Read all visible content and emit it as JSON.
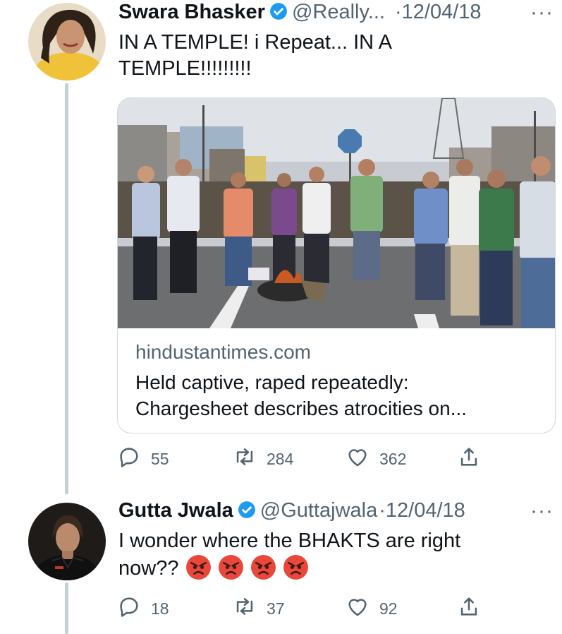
{
  "tweets": [
    {
      "name": "Swara Bhasker",
      "handle": "@Really...",
      "date": "·12/04/18",
      "text_line1": "IN A TEMPLE! i Repeat... IN A",
      "text_line2": "TEMPLE!!!!!!!!!",
      "card": {
        "domain": "hindustantimes.com",
        "title_line1": "Held captive, raped repeatedly:",
        "title_line2": "Chargesheet describes atrocities on..."
      },
      "replies": "55",
      "retweets": "284",
      "likes": "362"
    },
    {
      "name": "Gutta Jwala",
      "handle": "@Guttajwala",
      "date": "·12/04/18",
      "text_line1": "I wonder where the BHAKTS are right",
      "text_line2": "now??",
      "replies": "18",
      "retweets": "37",
      "likes": "92"
    }
  ],
  "more_glyph": "···",
  "icons": [
    "verified-badge-icon",
    "reply-icon",
    "retweet-icon",
    "like-icon",
    "share-icon",
    "more-icon",
    "angry-face-emoji"
  ],
  "colors": {
    "verified": "#1d9bf0",
    "icon": "#536471",
    "thread_line": "#c4cfd6",
    "card_border": "#cfd9de",
    "emoji": "#e8473a"
  }
}
